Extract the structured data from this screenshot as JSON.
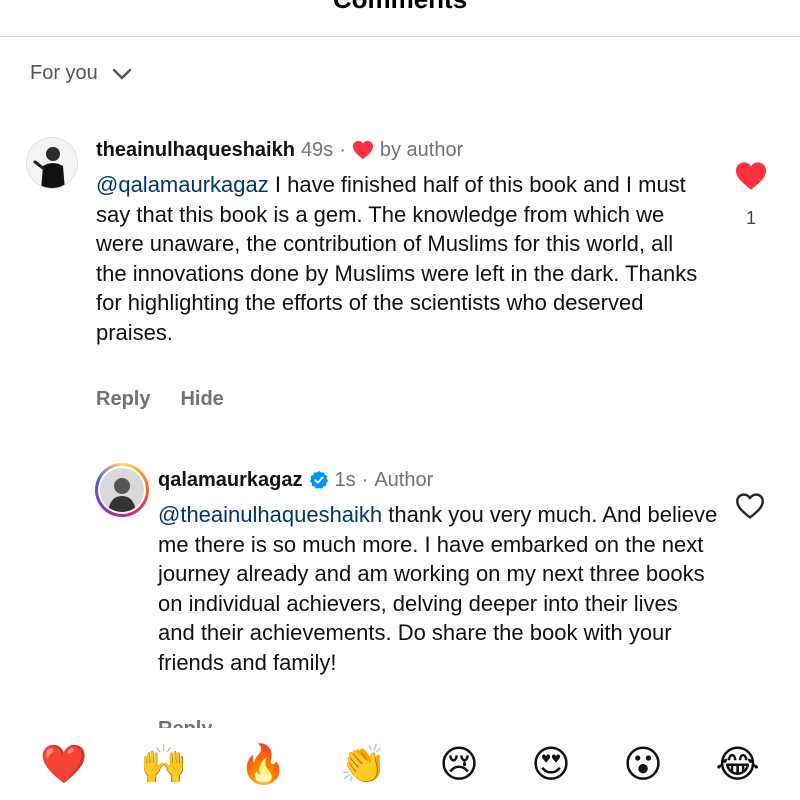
{
  "header": {
    "title": "Comments",
    "more_icon": "more-icon"
  },
  "sort": {
    "label": "For you",
    "icon": "chevron-down-icon"
  },
  "comments": [
    {
      "username": "theainulhaqueshaikh",
      "time": "49s",
      "liked_by_author_label": "by author",
      "mention": "@qalamaurkagaz",
      "body": " I have finished half of this book and I must say that this book is a gem. The knowledge from which we were unaware, the contribution of Muslims for this world, all the innovations done by Muslims were left in the dark. Thanks for highlighting the efforts of the scientists who deserved praises.",
      "like_count": "1",
      "liked": true,
      "actions": {
        "reply": "Reply",
        "hide": "Hide"
      }
    },
    {
      "username": "qalamaurkagaz",
      "verified": true,
      "time": "1s",
      "author_label": "Author",
      "mention": "@theainulhaqueshaikh",
      "body": " thank you very much. And believe me there is so much more. I have embarked on the next journey already and am working on my next three books on individual achievers, delving deeper into their lives and their achievements. Do share the book with your friends and family!",
      "liked": false,
      "actions": {
        "reply": "Reply"
      }
    }
  ],
  "emoji_bar": [
    "❤️",
    "🙌",
    "🔥",
    "👏",
    "😢",
    "😍",
    "😮",
    "😂"
  ],
  "colors": {
    "like_red": "#ff3040",
    "link_blue": "#00376b",
    "verified_blue": "#0095f6",
    "secondary_text": "#737373"
  }
}
